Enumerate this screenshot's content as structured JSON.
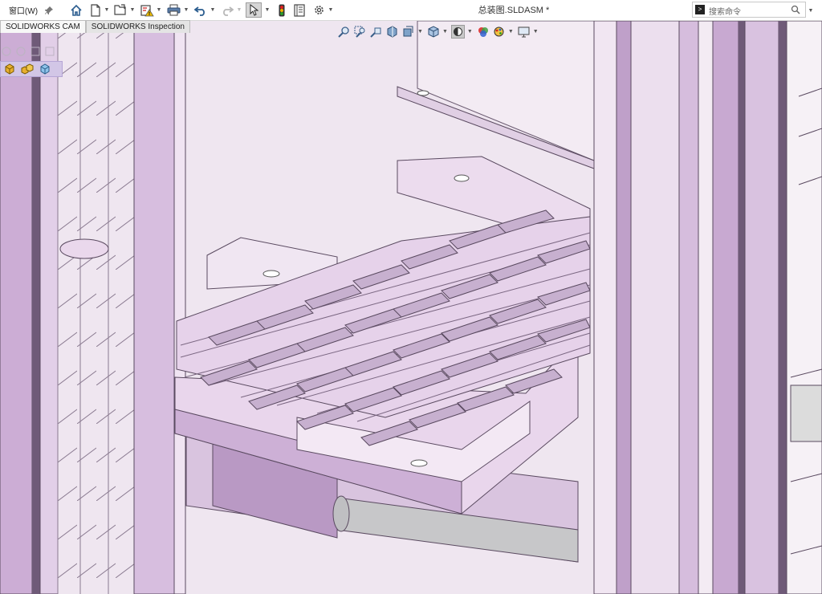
{
  "menu": {
    "window_label": "窗口(W)"
  },
  "document": {
    "title": "总装图.SLDASM *"
  },
  "search": {
    "placeholder": "搜索命令"
  },
  "tabs": [
    {
      "label": "SOLIDWORKS CAM"
    },
    {
      "label": "SOLIDWORKS Inspection"
    }
  ],
  "icons": {
    "pin": "pin-icon",
    "home": "home-icon",
    "new": "new-document-icon",
    "open": "open-folder-icon",
    "rebuild": "rebuild-warning-icon",
    "print": "print-icon",
    "undo": "undo-icon",
    "redo": "redo-icon",
    "select": "select-arrow-icon",
    "traffic": "traffic-light-icon",
    "file_props": "file-properties-icon",
    "options": "options-gear-icon",
    "search": "search-icon"
  },
  "colors": {
    "viewport_bg": "#efe6f0",
    "model_face": "#ead8ec",
    "model_shade": "#c9a8d2",
    "edge": "#5a4a60"
  }
}
